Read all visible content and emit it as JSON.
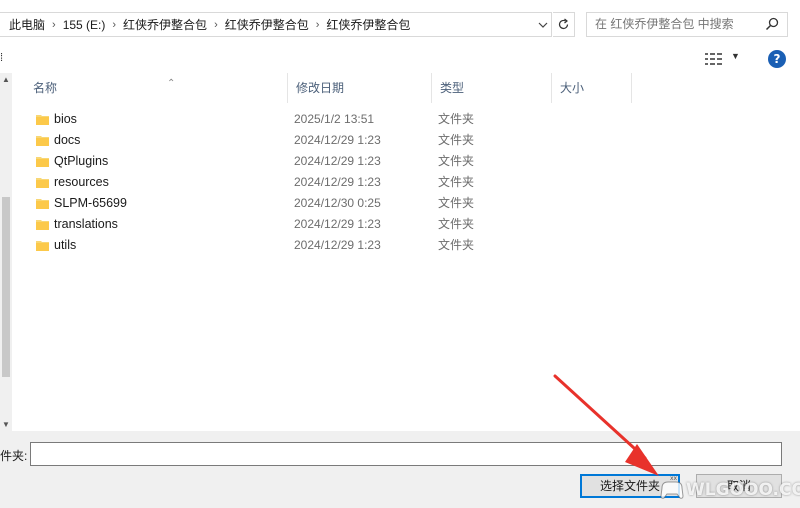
{
  "address": {
    "crumbs": [
      "此电脑",
      "155 (E:)",
      "红侠乔伊整合包",
      "红侠乔伊整合包",
      "红侠乔伊整合包"
    ],
    "separator": "›"
  },
  "search": {
    "placeholder": "在 红侠乔伊整合包 中搜索"
  },
  "toolbar": {
    "left_glyph": "⁞",
    "help_label": "?"
  },
  "columns": {
    "name": "名称",
    "date": "修改日期",
    "type": "类型",
    "size": "大小"
  },
  "files": [
    {
      "name": "bios",
      "date": "2025/1/2 13:51",
      "type": "文件夹"
    },
    {
      "name": "docs",
      "date": "2024/12/29 1:23",
      "type": "文件夹"
    },
    {
      "name": "QtPlugins",
      "date": "2024/12/29 1:23",
      "type": "文件夹"
    },
    {
      "name": "resources",
      "date": "2024/12/29 1:23",
      "type": "文件夹"
    },
    {
      "name": "SLPM-65699",
      "date": "2024/12/30 0:25",
      "type": "文件夹"
    },
    {
      "name": "translations",
      "date": "2024/12/29 1:23",
      "type": "文件夹"
    },
    {
      "name": "utils",
      "date": "2024/12/29 1:23",
      "type": "文件夹"
    }
  ],
  "footer": {
    "folder_label": "件夹:",
    "folder_value": "",
    "select_button": "选择文件夹",
    "cancel_button": "取消"
  },
  "watermark": {
    "text": "WLGOOO.COM"
  },
  "colors": {
    "accent": "#0078d7",
    "folder": "#f8d775",
    "arrow": "#e8322b",
    "help": "#1a5fb4"
  }
}
